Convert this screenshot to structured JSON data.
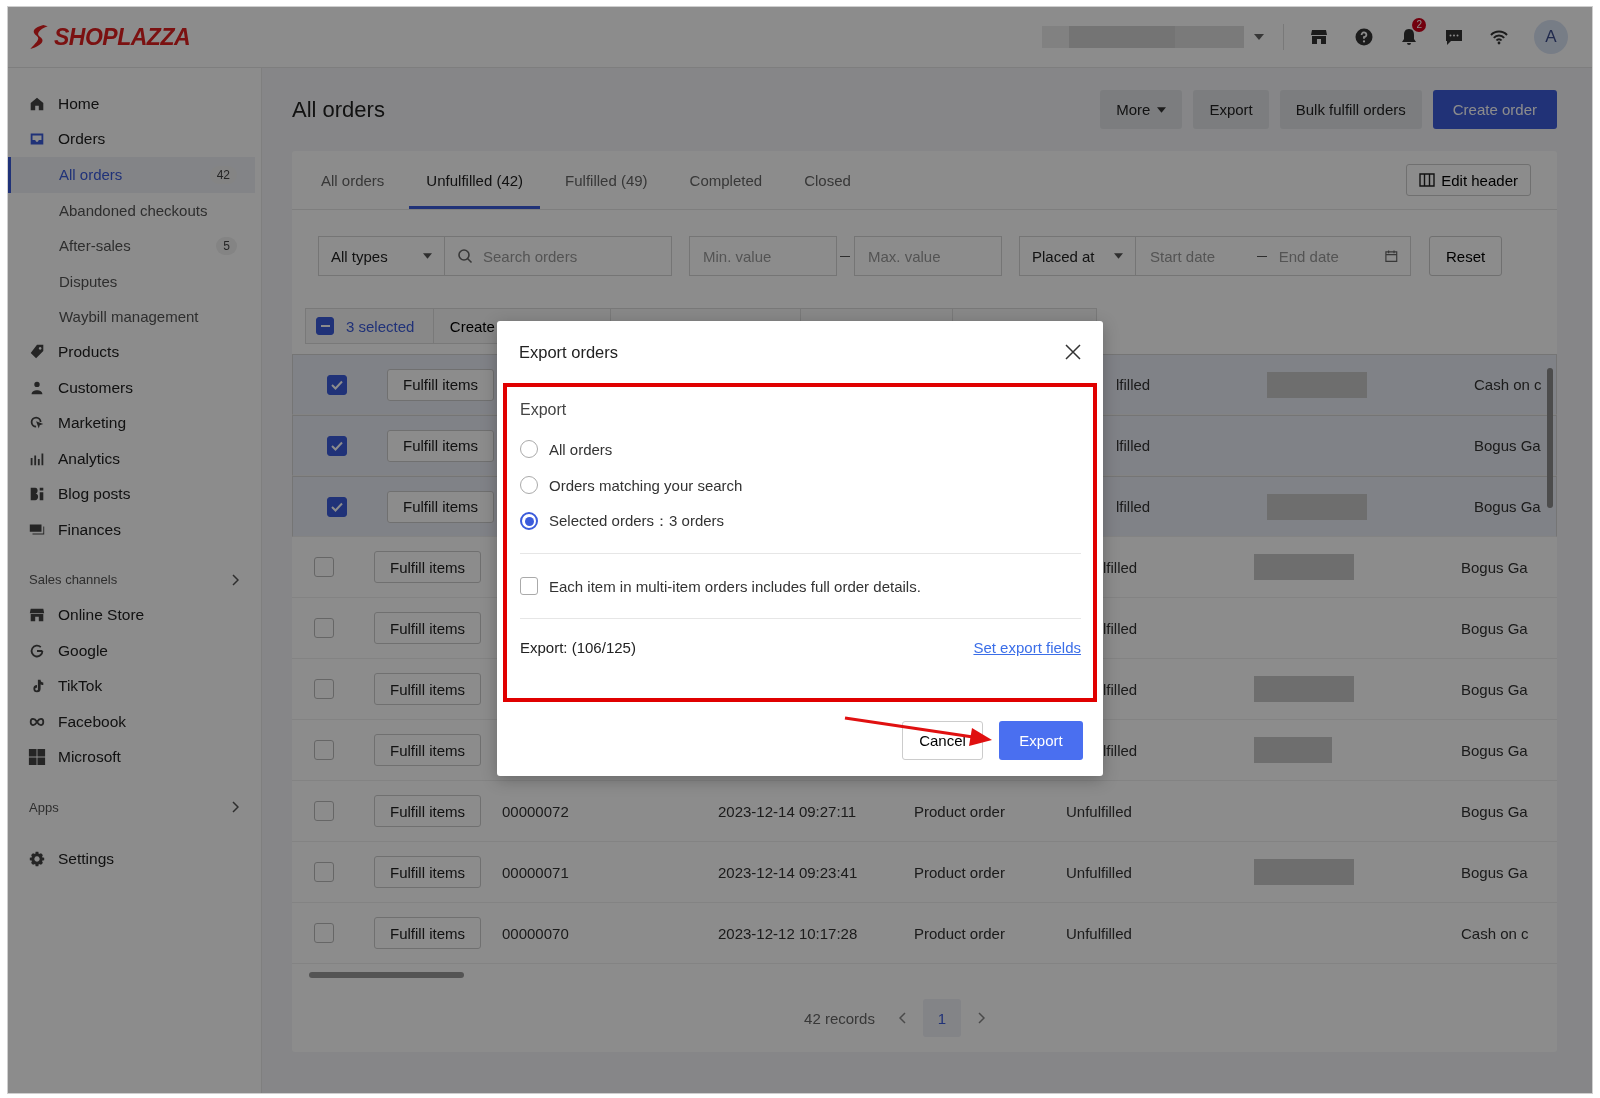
{
  "topbar": {
    "logo": "SHOPLAZZA",
    "notification_count": "2",
    "avatar_initial": "A"
  },
  "sidebar": {
    "groups": [
      {
        "items": [
          {
            "label": "Home",
            "selected": false
          },
          {
            "label": "Orders",
            "selected": true,
            "children": [
              {
                "label": "All orders",
                "count": "42",
                "selected": true
              },
              {
                "label": "Abandoned checkouts",
                "selected": false
              },
              {
                "label": "After-sales",
                "count": "5",
                "selected": false
              },
              {
                "label": "Disputes",
                "selected": false
              },
              {
                "label": "Waybill management",
                "selected": false
              }
            ]
          },
          {
            "label": "Products",
            "selected": false
          },
          {
            "label": "Customers",
            "selected": false
          },
          {
            "label": "Marketing",
            "selected": false
          },
          {
            "label": "Analytics",
            "selected": false
          },
          {
            "label": "Blog posts",
            "selected": false
          },
          {
            "label": "Finances",
            "selected": false
          }
        ]
      },
      {
        "title": "Sales channels",
        "items": [
          {
            "label": "Online Store",
            "selected": false
          },
          {
            "label": "Google",
            "selected": false
          },
          {
            "label": "TikTok",
            "selected": false
          },
          {
            "label": "Facebook",
            "selected": false
          },
          {
            "label": "Microsoft",
            "selected": false
          }
        ]
      },
      {
        "title": "Apps"
      },
      {
        "items": [
          {
            "label": "Settings",
            "selected": false
          }
        ]
      }
    ]
  },
  "page": {
    "title": "All orders",
    "actions": [
      {
        "label": "More",
        "kind": "dropdown"
      },
      {
        "label": "Export",
        "kind": "secondary"
      },
      {
        "label": "Bulk fulfill orders",
        "kind": "secondary"
      },
      {
        "label": "Create order",
        "kind": "primary"
      }
    ]
  },
  "tabs": [
    {
      "label": "All orders",
      "selected": false
    },
    {
      "label": "Unfulfilled (42)",
      "selected": true
    },
    {
      "label": "Fulfilled (49)",
      "selected": false
    },
    {
      "label": "Completed",
      "selected": false
    },
    {
      "label": "Closed",
      "selected": false
    }
  ],
  "edit_header": "Edit header",
  "filters": {
    "type": "All types",
    "search_placeholder": "Search orders",
    "min_placeholder": "Min. value",
    "max_placeholder": "Max. value",
    "date_type": "Placed at",
    "start_placeholder": "Start date",
    "end_placeholder": "End date",
    "reset": "Reset"
  },
  "bulk_bar": {
    "partial": true,
    "selected_count": "3 selected",
    "actions": [
      "Create"
    ]
  },
  "rows": [
    {
      "selected": true,
      "action": "Fulfill items",
      "status": "lfilled",
      "payment": "Cash on c"
    },
    {
      "selected": true,
      "action": "Fulfill items",
      "status": "lfilled",
      "payment": "Bogus Ga"
    },
    {
      "selected": true,
      "action": "Fulfill items",
      "status": "lfilled",
      "payment": "Bogus Ga"
    },
    {
      "selected": false,
      "action": "Fulfill items",
      "status": "lfilled",
      "payment": "Bogus Ga"
    },
    {
      "selected": false,
      "action": "Fulfill items",
      "status": "lfilled",
      "payment": "Bogus Ga"
    },
    {
      "selected": false,
      "action": "Fulfill items",
      "status": "lfilled",
      "payment": "Bogus Ga"
    },
    {
      "selected": false,
      "action": "Fulfill items",
      "status": "lfilled",
      "payment": "Bogus Ga"
    },
    {
      "selected": false,
      "action": "Fulfill items",
      "order": "00000072",
      "date": "2023-12-14 09:27:11",
      "type": "Product order",
      "status": "Unfulfilled",
      "payment": "Bogus Ga"
    },
    {
      "selected": false,
      "action": "Fulfill items",
      "order": "00000071",
      "date": "2023-12-14 09:23:41",
      "type": "Product order",
      "status": "Unfulfilled",
      "payment": "Bogus Ga"
    },
    {
      "selected": false,
      "action": "Fulfill items",
      "order": "00000070",
      "date": "2023-12-12 10:17:28",
      "type": "Product order",
      "status": "Unfulfilled",
      "payment": "Cash on c"
    }
  ],
  "pagination": {
    "total": "42 records",
    "pages": [
      {
        "label": "1",
        "selected": true
      }
    ]
  },
  "modal": {
    "title": "Export orders",
    "section_label": "Export",
    "options": [
      {
        "label": "All orders",
        "selected": false
      },
      {
        "label": "Orders matching your search",
        "selected": false
      },
      {
        "label": "Selected orders：3 orders",
        "selected": true
      }
    ],
    "detail_checkbox": {
      "label": "Each item in multi-item orders includes full order details.",
      "checked": false
    },
    "summary": "Export: (106/125)",
    "fields_link": "Set export fields",
    "cancel": "Cancel",
    "confirm": "Export"
  }
}
